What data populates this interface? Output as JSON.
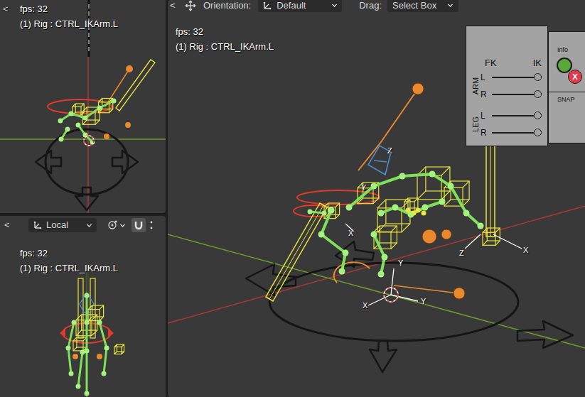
{
  "main_header": {
    "collapse": "<",
    "orientation_label": "Orientation:",
    "orientation_value": "Default",
    "drag_label": "Drag:",
    "drag_value": "Select Box"
  },
  "viewports": {
    "top_left": {
      "collapse": "<",
      "fps": "fps: 32",
      "object": "(1) Rig : CTRL_IKArm.L"
    },
    "bottom_left": {
      "collapse": "<",
      "orientation_value": "Local",
      "fps": "fps: 32",
      "object": "(1) Rig : CTRL_IKArm.L"
    },
    "main": {
      "fps": "fps: 32",
      "object": "(1) Rig : CTRL_IKArm.L",
      "axis_labels": [
        "Z",
        "Y",
        "X",
        "Y",
        "Z",
        "X",
        "X",
        "Y"
      ]
    }
  },
  "rig_ui": {
    "columns": [
      "FK",
      "IK"
    ],
    "groups": [
      {
        "label": "ARM",
        "rows": [
          {
            "side": "L",
            "level": 1
          },
          {
            "side": "R",
            "level": 1
          }
        ]
      },
      {
        "label": "LEG",
        "rows": [
          {
            "side": "L",
            "level": 1
          },
          {
            "side": "R",
            "level": 1
          }
        ]
      }
    ],
    "info": "Info",
    "close": "X",
    "snap": "SNAP"
  }
}
